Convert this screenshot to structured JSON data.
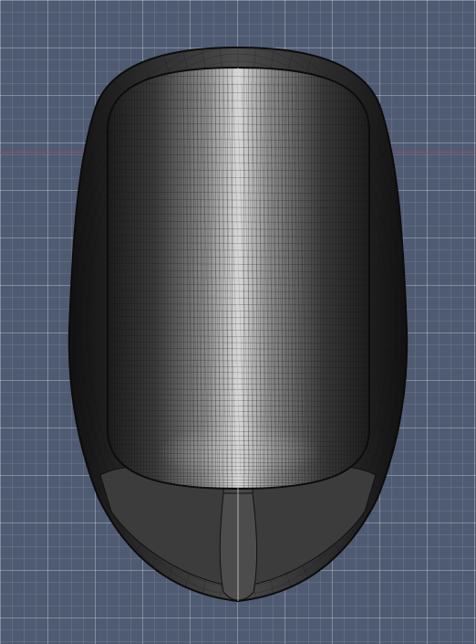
{
  "viewport": {
    "background_color": "#4f5b72",
    "grid_major_color": "#8893a6",
    "grid_minor_color": "#5d6880",
    "x_axis_color": "#b0465a"
  },
  "model": {
    "shading": "wireframe-on-shaded",
    "base_color": "#3a3a3a",
    "wire_color": "#1a1a1a",
    "highlight_color": "#d6d6d6",
    "shape": "helmet-shell"
  }
}
